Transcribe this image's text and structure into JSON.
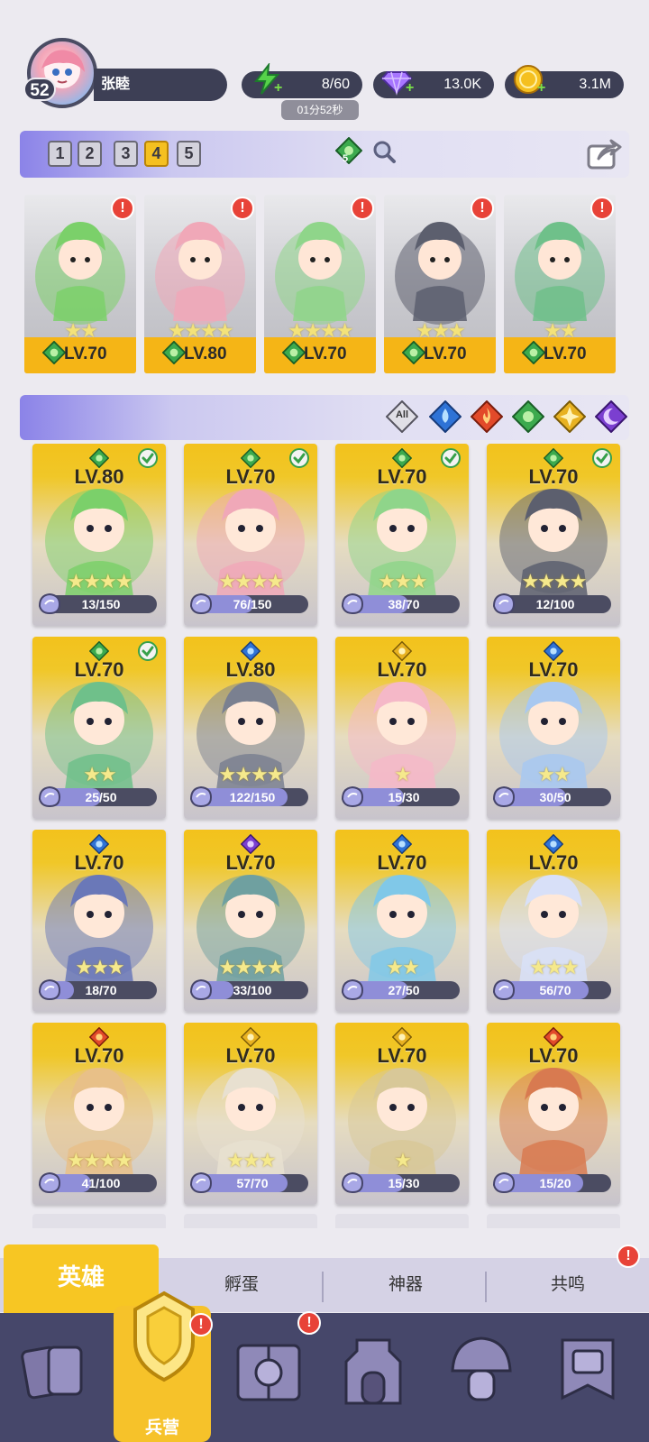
{
  "player": {
    "level": "52",
    "name": "张睦"
  },
  "resources": {
    "energy": "8/60",
    "energy_timer": "01分52秒",
    "gems": "13.0K",
    "gold": "3.1M"
  },
  "team_tabs": [
    "1",
    "2",
    "3",
    "4",
    "5"
  ],
  "team_active": "4",
  "team_element_count": "5",
  "lineup": [
    {
      "level": "LV.70",
      "stars": 2
    },
    {
      "level": "LV.80",
      "stars": 4
    },
    {
      "level": "LV.70",
      "stars": 4
    },
    {
      "level": "LV.70",
      "stars": 3
    },
    {
      "level": "LV.70",
      "stars": 2
    }
  ],
  "filter_all_label": "All",
  "heroes": [
    {
      "level": "LV.80",
      "progress": "13/150",
      "element": "green",
      "stars": 4,
      "check": true
    },
    {
      "level": "LV.70",
      "progress": "76/150",
      "element": "green",
      "stars": 4,
      "check": true
    },
    {
      "level": "LV.70",
      "progress": "38/70",
      "element": "green",
      "stars": 3,
      "check": true
    },
    {
      "level": "LV.70",
      "progress": "12/100",
      "element": "green",
      "stars": 4,
      "check": true
    },
    {
      "level": "LV.70",
      "progress": "25/50",
      "element": "green",
      "stars": 2,
      "check": true
    },
    {
      "level": "LV.80",
      "progress": "122/150",
      "element": "blue",
      "stars": 4,
      "check": false
    },
    {
      "level": "LV.70",
      "progress": "15/30",
      "element": "yellow",
      "stars": 1,
      "check": false
    },
    {
      "level": "LV.70",
      "progress": "30/50",
      "element": "blue",
      "stars": 2,
      "check": false
    },
    {
      "level": "LV.70",
      "progress": "18/70",
      "element": "blue",
      "stars": 3,
      "check": false
    },
    {
      "level": "LV.70",
      "progress": "33/100",
      "element": "purple",
      "stars": 4,
      "check": false
    },
    {
      "level": "LV.70",
      "progress": "27/50",
      "element": "blue",
      "stars": 2,
      "check": false
    },
    {
      "level": "LV.70",
      "progress": "56/70",
      "element": "blue",
      "stars": 3,
      "check": false
    },
    {
      "level": "LV.70",
      "progress": "41/100",
      "element": "red",
      "stars": 4,
      "check": false
    },
    {
      "level": "LV.70",
      "progress": "57/70",
      "element": "yellow",
      "stars": 3,
      "check": false
    },
    {
      "level": "LV.70",
      "progress": "15/30",
      "element": "yellow",
      "stars": 1,
      "check": false
    },
    {
      "level": "LV.70",
      "progress": "15/20",
      "element": "red",
      "stars": 0,
      "check": false
    }
  ],
  "subtabs": {
    "heroes": "英雄",
    "hatch": "孵蛋",
    "artifact": "神器",
    "resonance": "共鸣"
  },
  "nav": {
    "barracks": "兵营"
  },
  "colors": {
    "gold": "#f5b516",
    "nav": "#46476a",
    "accent": "#8b83e8"
  }
}
